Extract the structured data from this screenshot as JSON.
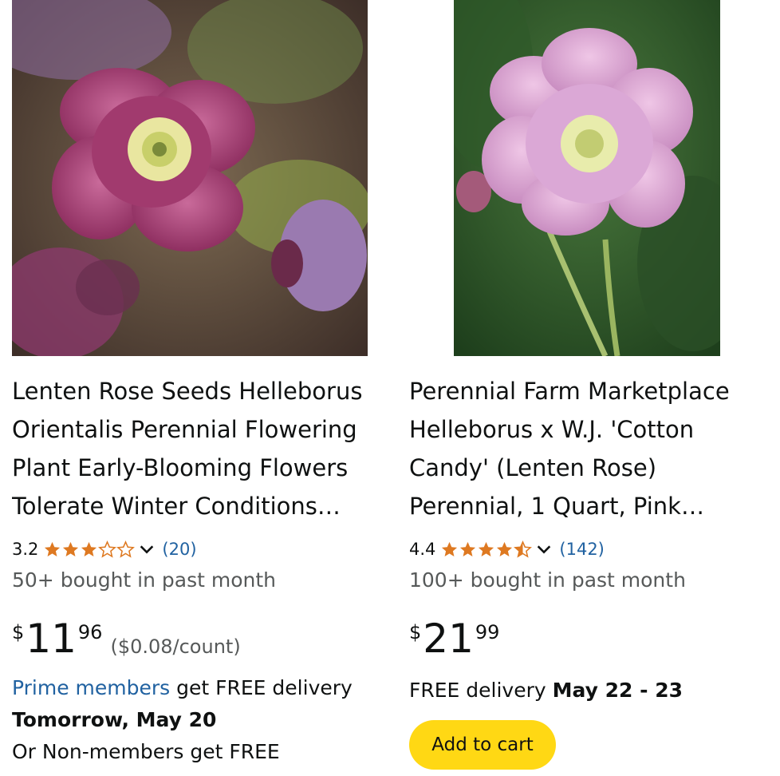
{
  "products": [
    {
      "title": "Lenten Rose Seeds Helleborus Orientalis Perennial Flowering Plant Early-Blooming Flowers Tolerate Winter Conditions…",
      "rating": "3.2",
      "rating_value": 3.2,
      "review_count": "(20)",
      "bought": "50+ bought in past month",
      "price_symbol": "$",
      "price_whole": "11",
      "price_fraction": "96",
      "unit_price": "($0.08/count)",
      "delivery_link": "Prime members",
      "delivery_text": " get FREE delivery",
      "delivery_date": "Tomorrow, May 20",
      "delivery_extra": "Or Non-members get FREE"
    },
    {
      "title": "Perennial Farm Marketplace Helleborus x W.J. 'Cotton Candy' (Lenten Rose) Perennial, 1 Quart, Pink…",
      "rating": "4.4",
      "rating_value": 4.4,
      "review_count": "(142)",
      "bought": "100+ bought in past month",
      "price_symbol": "$",
      "price_whole": "21",
      "price_fraction": "99",
      "delivery_text": "FREE delivery ",
      "delivery_date": "May 22 - 23",
      "add_to_cart": "Add to cart"
    }
  ],
  "colors": {
    "star": "#de7921",
    "link": "#2162a1",
    "cart_button": "#ffd814"
  },
  "icons": [
    "star-icon",
    "chevron-down-icon"
  ]
}
